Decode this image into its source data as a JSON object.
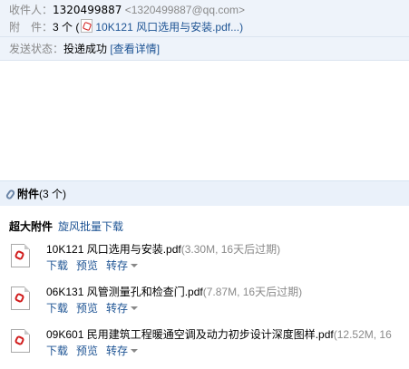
{
  "header": {
    "sender_label": "收件人：",
    "sender_name": "1320499887",
    "sender_email": "<1320499887@qq.com>",
    "attach_label": "附　件：",
    "attach_count": "3 个",
    "attach_open": "(",
    "attach_preview": "10K121 风口选用与安装.pdf...)"
  },
  "status": {
    "label": "发送状态：",
    "value": "投递成功",
    "detail_link": "[查看详情]"
  },
  "attachments": {
    "title": "附件",
    "count": "(3 个)",
    "big_label": "超大附件",
    "batch_download": "旋风批量下载",
    "files": [
      {
        "name": "10K121 风口选用与安装.pdf",
        "meta": "(3.30M, 16天后过期)"
      },
      {
        "name": "06K131 风管测量孔和检查门.pdf",
        "meta": "(7.87M, 16天后过期)"
      },
      {
        "name": "09K601 民用建筑工程暖通空调及动力初步设计深度图样.pdf",
        "meta": "(12.52M, 16"
      }
    ],
    "actions": {
      "download": "下载",
      "preview": "预览",
      "save": "转存"
    }
  },
  "icons": {
    "file": "pdf-icon",
    "clip": "paperclip-icon",
    "dropdown": "caret-down-icon"
  }
}
